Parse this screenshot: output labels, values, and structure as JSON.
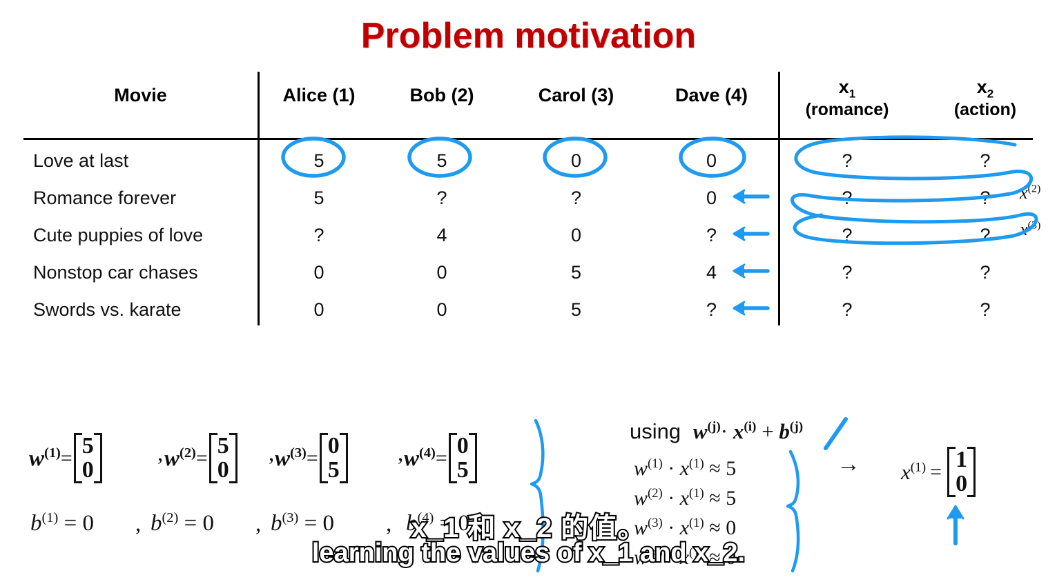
{
  "slide": {
    "title": "Problem motivation",
    "title_color": "#c00000",
    "accent_color": "#1e9bf0"
  },
  "table": {
    "columns": [
      "Movie",
      "Alice (1)",
      "Bob (2)",
      "Carol (3)",
      "Dave (4)"
    ],
    "feature_columns": [
      {
        "symbol": "x",
        "index": "1",
        "caption": "(romance)"
      },
      {
        "symbol": "x",
        "index": "2",
        "caption": "(action)"
      }
    ],
    "rows": [
      {
        "movie": "Love at last",
        "alice": "5",
        "bob": "5",
        "carol": "0",
        "dave": "0",
        "x1": "?",
        "x2": "?"
      },
      {
        "movie": "Romance forever",
        "alice": "5",
        "bob": "?",
        "carol": "?",
        "dave": "0",
        "x1": "?",
        "x2": "?"
      },
      {
        "movie": "Cute puppies of love",
        "alice": "?",
        "bob": "4",
        "carol": "0",
        "dave": "?",
        "x1": "?",
        "x2": "?"
      },
      {
        "movie": "Nonstop car chases",
        "alice": "0",
        "bob": "0",
        "carol": "5",
        "dave": "4",
        "x1": "?",
        "x2": "?"
      },
      {
        "movie": "Swords vs. karate",
        "alice": "0",
        "bob": "0",
        "carol": "5",
        "dave": "?",
        "x1": "?",
        "x2": "?"
      }
    ]
  },
  "annotations": {
    "row_labels": [
      {
        "text": "x",
        "sup": "(2)"
      },
      {
        "text": "x",
        "sup": "(3)"
      }
    ]
  },
  "params": {
    "weights": [
      {
        "name": "w",
        "sup": "(1)",
        "values": [
          "5",
          "0"
        ]
      },
      {
        "name": "w",
        "sup": "(2)",
        "values": [
          "5",
          "0"
        ]
      },
      {
        "name": "w",
        "sup": "(3)",
        "values": [
          "0",
          "5"
        ]
      },
      {
        "name": "w",
        "sup": "(4)",
        "values": [
          "0",
          "5"
        ]
      }
    ],
    "biases": [
      {
        "name": "b",
        "sup": "(1)",
        "value": "0"
      },
      {
        "name": "b",
        "sup": "(2)",
        "value": "0"
      },
      {
        "name": "b",
        "sup": "(3)",
        "value": "0"
      },
      {
        "name": "b",
        "sup": "(4)",
        "value": "0"
      }
    ],
    "separator": ","
  },
  "derivation": {
    "using_label": "using",
    "using_expr": {
      "w": "w",
      "w_sup": "(j)",
      "dot": "·",
      "x": "x",
      "x_sup": "(i)",
      "plus": "+",
      "b": "b",
      "b_sup": "(j)"
    },
    "equations": [
      {
        "w": "w",
        "w_sup": "(1)",
        "x": "x",
        "x_sup": "(1)",
        "rel": "≈",
        "value": "5"
      },
      {
        "w": "w",
        "w_sup": "(2)",
        "x": "x",
        "x_sup": "(1)",
        "rel": "≈",
        "value": "5"
      },
      {
        "w": "w",
        "w_sup": "(3)",
        "x": "x",
        "x_sup": "(1)",
        "rel": "≈",
        "value": "0"
      },
      {
        "w": "w",
        "w_sup": "(4)",
        "x": "x",
        "x_sup": "(1)",
        "rel": "≈",
        "value": "0"
      }
    ],
    "implies": "→",
    "result": {
      "name": "x",
      "sup": "(1)",
      "eq": "=",
      "values": [
        "1",
        "0"
      ]
    }
  },
  "subtitles": {
    "chinese": "x_1 和 x_2 的值。",
    "english": "learning the values of x_1 and x_2."
  }
}
